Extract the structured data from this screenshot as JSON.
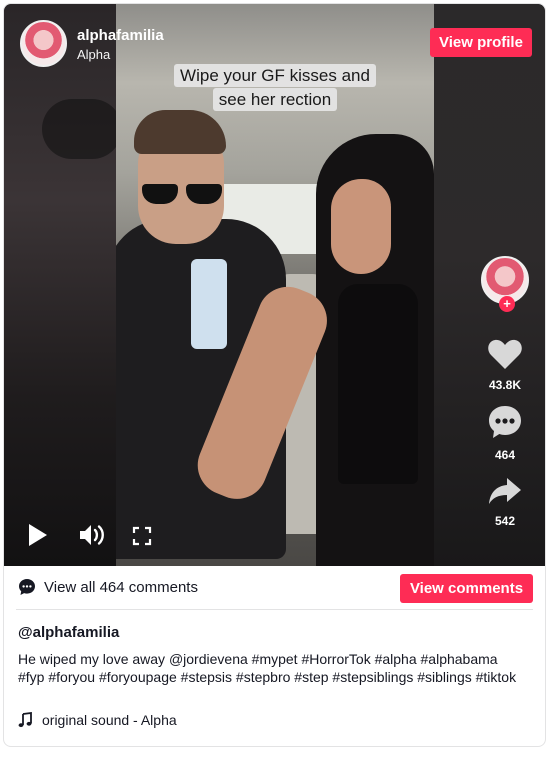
{
  "author": {
    "username": "alphafamilia",
    "display_name": "Alpha"
  },
  "header": {
    "view_profile_label": "View profile"
  },
  "video": {
    "caption_lines": [
      "Wipe your GF kisses and",
      "see her rection"
    ],
    "likes": "43.8K",
    "comments": "464",
    "shares": "542"
  },
  "comments_bar": {
    "view_all_label": "View all 464 comments",
    "view_comments_label": "View comments"
  },
  "post": {
    "handle": "@alphafamilia",
    "description": "He wiped my love away @jordievena  #mypet #HorrorTok #alpha #alphabama #fyp #foryou #foryoupage #stepsis #stepbro #step #stepsiblings #siblings #tiktok",
    "sound": "original sound - Alpha"
  },
  "icons": {
    "play": "play-icon",
    "volume": "volume-icon",
    "fullscreen": "fullscreen-icon",
    "like": "heart-icon",
    "comment": "comment-icon",
    "share": "share-icon",
    "comments_bar": "comment-bubble-icon",
    "music": "music-note-icon"
  },
  "colors": {
    "accent": "#fe2c55",
    "text": "#161823"
  }
}
